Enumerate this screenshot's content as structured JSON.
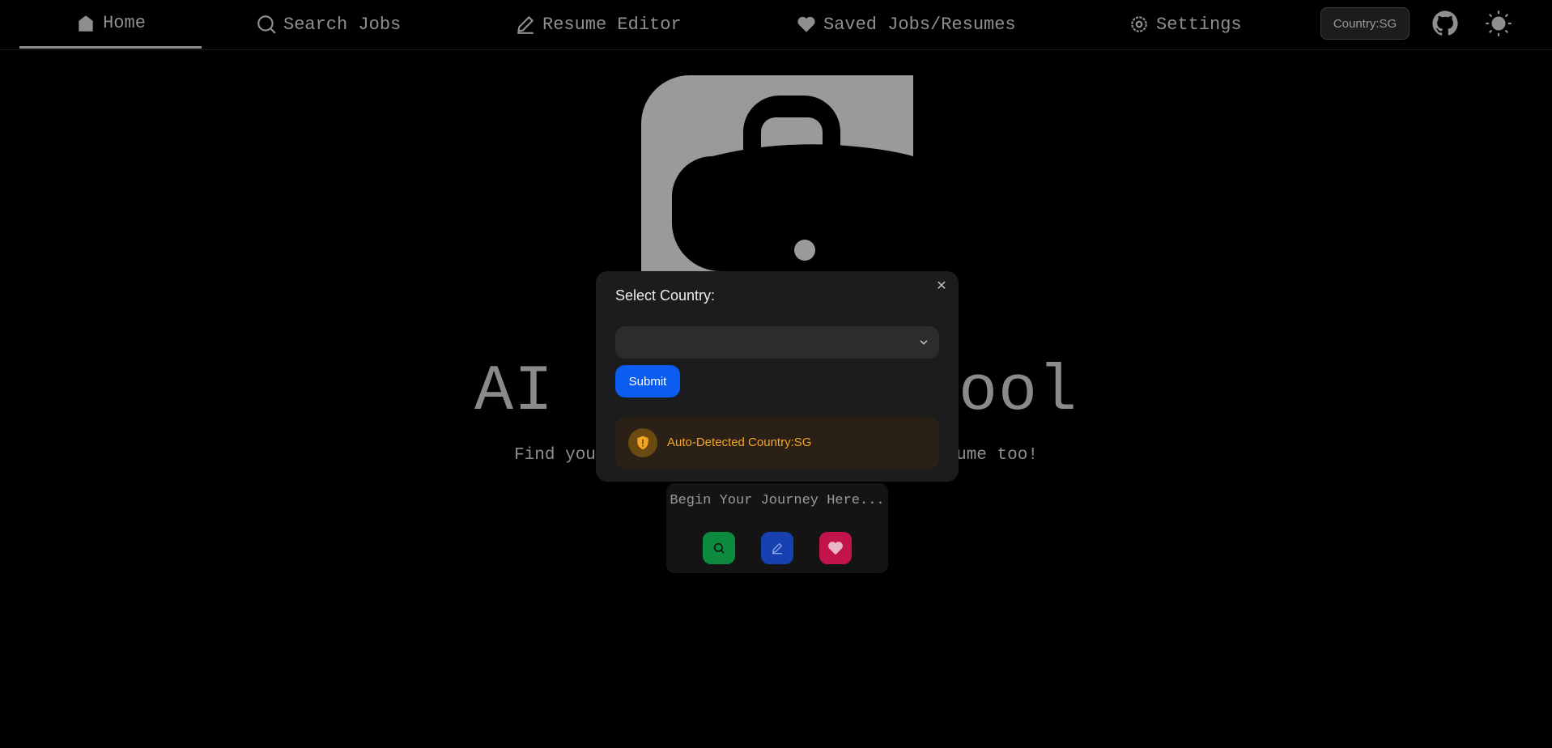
{
  "nav": {
    "items": [
      {
        "label": "Home",
        "icon": "home-icon"
      },
      {
        "label": "Search Jobs",
        "icon": "search-icon"
      },
      {
        "label": "Resume Editor",
        "icon": "pencil-icon"
      },
      {
        "label": "Saved Jobs/Resumes",
        "icon": "heart-icon"
      },
      {
        "label": "Settings",
        "icon": "gear-icon"
      }
    ],
    "country_button": "Country:SG",
    "github_icon": "github-icon",
    "theme_icon": "sun-icon"
  },
  "hero": {
    "logo_icon": "briefcase-icon",
    "title_left": "AI",
    "title_right": "ool",
    "subtitle_left": "Find your",
    "subtitle_right": "sume too!",
    "journey_text": "Begin Your Journey Here...",
    "quick_icons": [
      "search-icon",
      "pencil-icon",
      "heart-icon"
    ]
  },
  "modal": {
    "title": "Select Country:",
    "select_value": "",
    "submit_label": "Submit",
    "alert_text": "Auto-Detected Country:SG"
  },
  "colors": {
    "background": "#000000",
    "modal_bg": "#1c1c1e",
    "submit_blue": "#0b5cf0",
    "warning": "#f5a524",
    "quick_green": "#0d8a3d",
    "quick_blue": "#1740b0",
    "quick_pink": "#c2134a"
  }
}
